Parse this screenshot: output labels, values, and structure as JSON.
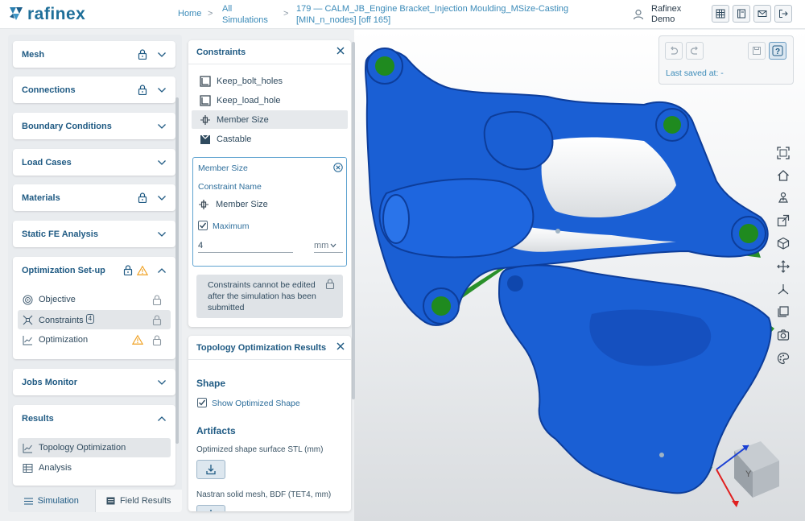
{
  "header": {
    "logo_text": "rafinex",
    "breadcrumb": {
      "home": "Home",
      "sep": ">",
      "all_simulations": "All Simulations",
      "current": "179 — CALM_JB_Engine Bracket_Injection Moulding_MSize-Casting [MIN_n_nodes] [off 165]"
    },
    "user": {
      "first": "Rafinex",
      "last": "Demo",
      "icon": "user-icon"
    },
    "buttons": [
      "table-icon",
      "notebook-icon",
      "mail-icon",
      "logout-icon"
    ]
  },
  "sidebar": {
    "sections": [
      {
        "label": "Mesh",
        "locked": true,
        "expanded": false
      },
      {
        "label": "Connections",
        "locked": true,
        "expanded": false
      },
      {
        "label": "Boundary Conditions",
        "locked": false,
        "expanded": false
      },
      {
        "label": "Load Cases",
        "locked": false,
        "expanded": false
      },
      {
        "label": "Materials",
        "locked": true,
        "expanded": false
      },
      {
        "label": "Static FE Analysis",
        "locked": false,
        "expanded": false
      },
      {
        "label": "Optimization Set-up",
        "locked": true,
        "warning": true,
        "expanded": true
      },
      {
        "label": "Jobs Monitor",
        "locked": false,
        "expanded": false
      },
      {
        "label": "Results",
        "locked": false,
        "expanded": true
      }
    ],
    "optimization_items": [
      {
        "label": "Objective",
        "icon": "target-icon"
      },
      {
        "label": "Constraints",
        "badge": "4",
        "icon": "constraints-icon"
      },
      {
        "label": "Optimization",
        "icon": "chart-line-icon",
        "warning": true
      }
    ],
    "results_items": [
      {
        "label": "Topology Optimization",
        "icon": "chart-line-icon"
      },
      {
        "label": "Analysis",
        "icon": "table-icon"
      }
    ],
    "tabs": {
      "simulation": "Simulation",
      "field_results": "Field Results"
    }
  },
  "constraints_panel": {
    "title": "Constraints",
    "items": [
      {
        "label": "Keep_bolt_holes",
        "icon": "keep-icon"
      },
      {
        "label": "Keep_load_hole",
        "icon": "keep-icon"
      },
      {
        "label": "Member Size",
        "icon": "member-size-icon"
      },
      {
        "label": "Castable",
        "icon": "castable-icon"
      }
    ],
    "member_size": {
      "title": "Member Size",
      "constraint_name_label": "Constraint Name",
      "constraint_name_value": "Member Size",
      "maximum_label": "Maximum",
      "maximum_checked": true,
      "value": "4",
      "unit": "mm"
    },
    "note": "Constraints cannot be edited after the simulation has been submitted"
  },
  "results_panel": {
    "title": "Topology Optimization Results",
    "shape_heading": "Shape",
    "show_optimized_label": "Show Optimized Shape",
    "show_optimized_checked": true,
    "artifacts_heading": "Artifacts",
    "artifacts": [
      {
        "label": "Optimized shape surface STL (mm)"
      },
      {
        "label": "Nastran solid mesh, BDF (TET4, mm)"
      }
    ]
  },
  "viewer": {
    "last_saved_label": "Last saved at: -",
    "side_tools": [
      "fit-view-icon",
      "home-view-icon",
      "anchor-icon",
      "export-view-icon",
      "cube-view-icon",
      "move-icon",
      "axes-icon",
      "layers-icon",
      "camera-icon",
      "palette-icon"
    ],
    "colors": {
      "part": "#1a5fd4",
      "part_dark": "#0d3d9a",
      "connectors": "#1f8a1f"
    },
    "gizmo_label": "Y"
  }
}
